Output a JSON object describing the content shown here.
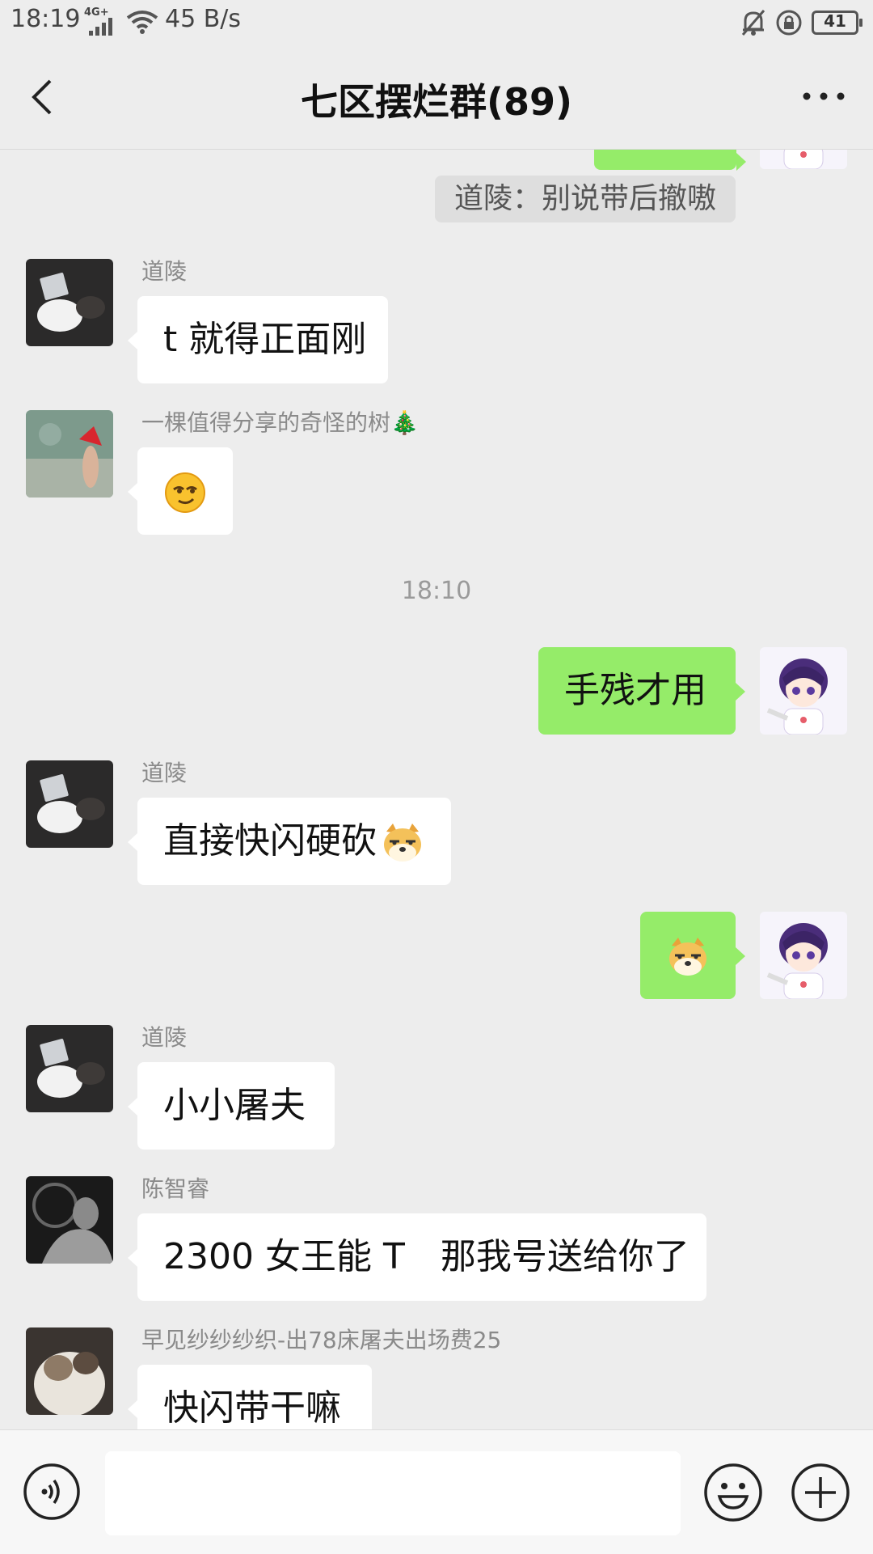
{
  "status_bar": {
    "time": "18:19",
    "network_type": "4G+",
    "net_speed": "45 B/s",
    "battery": "41"
  },
  "header": {
    "title": "七区摆烂群(89)"
  },
  "messages": {
    "top_system_notice": "道陵：别说带后撤嗷",
    "m1": {
      "sender": "道陵",
      "text": "t 就得正面刚"
    },
    "m2": {
      "sender": "一棵值得分享的奇怪的树🎄",
      "emoji": "smirk-emoji"
    },
    "time_divider": "18:10",
    "m3": {
      "text": "手残才用"
    },
    "m4": {
      "sender": "道陵",
      "text": "直接快闪硬砍",
      "emoji": "doge-emoji"
    },
    "m5": {
      "emoji": "doge-emoji"
    },
    "m6": {
      "sender": "道陵",
      "text": "小小屠夫"
    },
    "m7": {
      "sender": "陈智睿",
      "text": "2300 女王能 T　那我号送给你了"
    },
    "m8": {
      "sender": "早见纱纱纱织-出78床屠夫出场费25",
      "text": "快闪带干嘛"
    }
  },
  "colors": {
    "background": "#ededed",
    "bubble_out": "#95ec69",
    "bubble_in": "#ffffff"
  },
  "icons": [
    "back-arrow-icon",
    "more-icon",
    "voice-icon",
    "emoji-icon",
    "plus-icon"
  ],
  "input": {
    "value": ""
  }
}
